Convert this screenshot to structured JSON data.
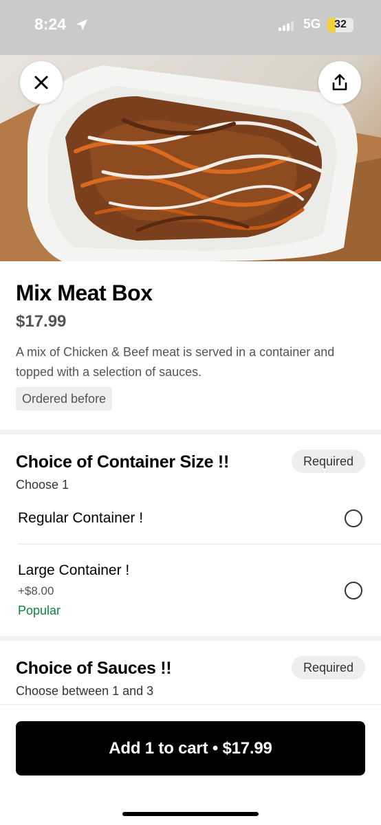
{
  "status_bar": {
    "time": "8:24",
    "network": "5G",
    "battery": "32",
    "icons": [
      "location-arrow-icon",
      "signal-bars-icon",
      "battery-icon"
    ]
  },
  "hero": {
    "image_subject": "Mix meat box with sauces in a white container",
    "close_icon": "close-icon",
    "share_icon": "share-icon"
  },
  "product": {
    "title": "Mix Meat Box",
    "price": "$17.99",
    "description": "A mix of Chicken & Beef meat is served in a container and topped with a selection of sauces.",
    "ordered_badge": "Ordered before"
  },
  "groups": [
    {
      "title": "Choice of Container Size !!",
      "subtitle": "Choose 1",
      "required": "Required",
      "options": [
        {
          "label": "Regular Container !",
          "price": "",
          "tag": ""
        },
        {
          "label": "Large Container !",
          "price": "+$8.00",
          "tag": "Popular"
        }
      ]
    },
    {
      "title": "Choice of Sauces !!",
      "subtitle": "Choose between 1 and 3",
      "required": "Required",
      "options": []
    }
  ],
  "cart_button": "Add 1 to cart • $17.99",
  "colors": {
    "accent_green": "#0e8345",
    "button_black": "#000000",
    "badge_gray": "#eeeeee",
    "battery_yellow": "#f4d03a"
  }
}
